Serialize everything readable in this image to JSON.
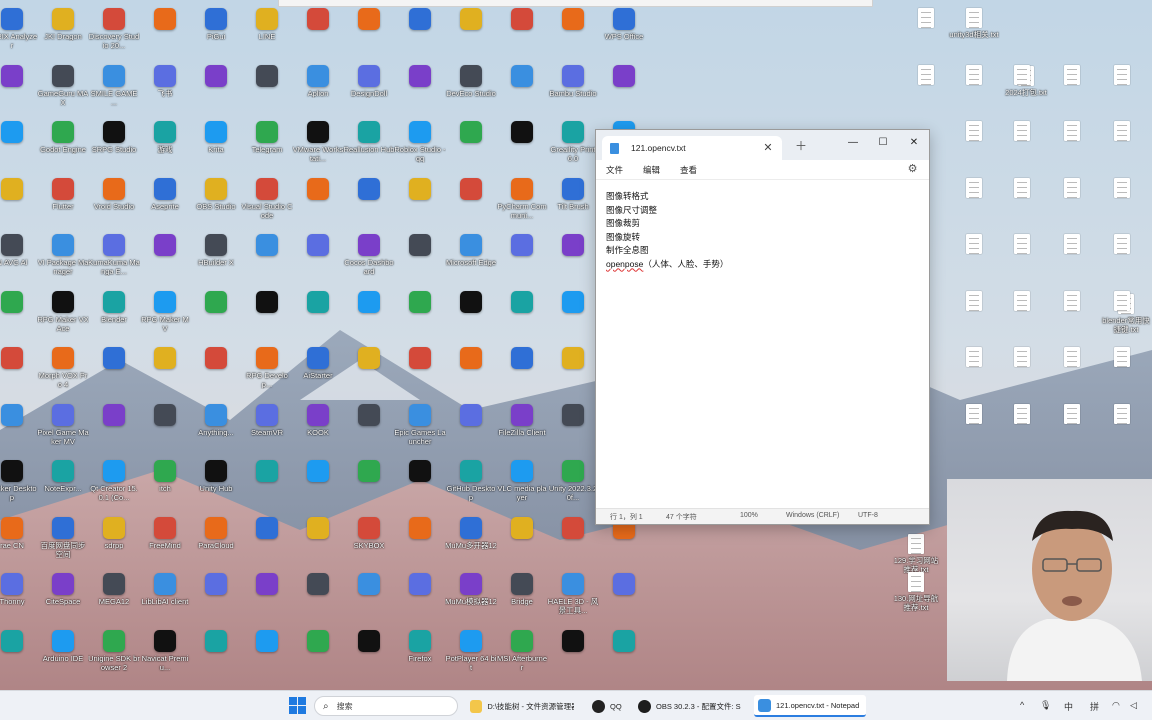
{
  "desktop": {
    "columns": [
      [
        "STRIX Analyzer",
        "",
        "",
        "",
        "N AVG Al",
        "",
        "",
        "",
        "Docker Desktop",
        "rae CN",
        "Thonny",
        ""
      ],
      [
        "JK! Dragon",
        "GameGuru MAX",
        "Godot Engine",
        "Flutter",
        "VI Package Manager",
        "RPG Maker VX Ace",
        "Morph VOX Pro 4",
        "Pixel Game Maker MV",
        "NoteExpr...",
        "百度网盘同步空间",
        "CiteSpace",
        "Arduino IDE"
      ],
      [
        "Discovery Studio 20...",
        "SMILE GAME ...",
        "SRPG Studio",
        "Vroid Studio",
        "KumaKuma Manga E...",
        "Blender",
        "",
        "",
        "Qt Creator 15.0.1 (Co...",
        "sdrpp",
        "MEGA12",
        "Unigine SDK browser 2"
      ],
      [
        "",
        "飞书",
        "游戏",
        "Aseprite",
        "",
        "RPG Maker MV",
        "",
        "",
        "itch",
        "FreeMind",
        "LibLibAI client",
        "Navicat Premiu..."
      ],
      [
        "PiGui",
        "",
        "Krita",
        "OBS Studio",
        "HBuilder X",
        "",
        "",
        "Anything...",
        "Unity Hub",
        "ParaCloud",
        "",
        ""
      ],
      [
        "LINE",
        "",
        "Telegram",
        "Visual Studio Code",
        "",
        "",
        "RPG Develop...",
        "SteamVR",
        "",
        "",
        "",
        ""
      ],
      [
        "",
        "Aplion",
        "VMware Workstati...",
        "",
        "",
        "",
        "AiStarter",
        "KOOK",
        "",
        "",
        "",
        ""
      ],
      [
        "",
        "DesignDoll",
        "Reallusion Hub",
        "",
        "Cocos Dashboard",
        "",
        "",
        "",
        "",
        "SKYBOX",
        "",
        ""
      ],
      [
        "",
        "",
        "Roblox Studio - qq",
        "",
        "",
        "",
        "",
        "Epic Games Launcher",
        "",
        "",
        "",
        "Firefox"
      ],
      [
        "",
        "DevEco Studio",
        "",
        "",
        "Microsoft Edge",
        "",
        "",
        "",
        "GitHub Desktop",
        "MuMu多开器12",
        "MuMu模拟器12",
        "PotPlayer 64 bit"
      ],
      [
        "",
        "",
        "",
        "PyCharm Communi...",
        "",
        "",
        "",
        "FileZilla Client",
        "VLC media player",
        "",
        "Bridge",
        "MSI Afterburner"
      ],
      [
        "",
        "Bambu Studio",
        "Greaility Print 6.0",
        "Tilt Brush",
        "",
        "",
        "",
        "",
        "Unity 2022.3.20f...",
        "",
        "HAELE 3D - 风景工具...",
        ""
      ],
      [
        "WPS Office",
        "",
        "RPG Maker MZ",
        "JianyingPro Materials",
        "",
        "",
        "Bandizip",
        "JoyToKey",
        "",
        "",
        "",
        ""
      ]
    ],
    "right_files": [
      "unity3d相关.txt",
      "2024打包.txt",
      "129.学习网站推荐.txt",
      "130.网址导航推荐.txt",
      "blender常用快捷键.txt"
    ]
  },
  "notepad": {
    "tab_title": "121.opencv.txt",
    "menu": [
      "文件",
      "编辑",
      "查看"
    ],
    "lines": [
      "图像转格式",
      "图像尺寸调整",
      "图像裁剪",
      "图像旋转",
      "制作全息图"
    ],
    "last_line_word": "openpose",
    "last_line_rest": "（人体、人脸、手势）",
    "status": {
      "position": "行 1，列 1",
      "chars": "47 个字符",
      "zoom": "100%",
      "eol": "Windows (CRLF)",
      "encoding": "UTF-8"
    }
  },
  "taskbar": {
    "search_placeholder": "搜索",
    "items": [
      {
        "label": "D:\\技能树 - 文件资源管理器"
      },
      {
        "label": "QQ"
      },
      {
        "label": "OBS 30.2.3 - 配置文件: S"
      },
      {
        "label": "121.opencv.txt - Notepad"
      }
    ],
    "tray": [
      "^",
      "中",
      "拼"
    ]
  },
  "colors": {
    "accent": "#2b7de0",
    "folder": "#f3c64a"
  }
}
